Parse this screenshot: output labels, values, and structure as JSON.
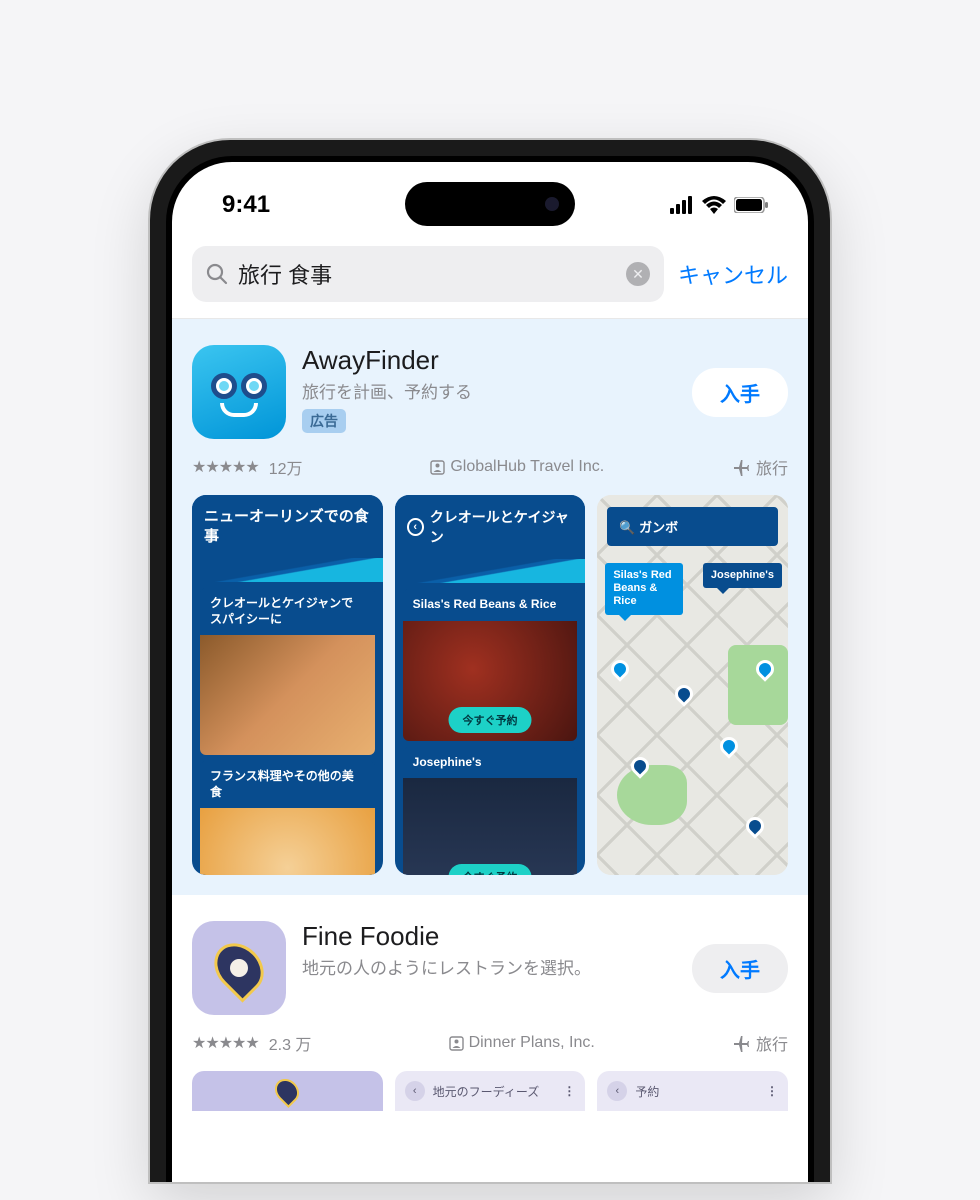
{
  "status": {
    "time": "9:41"
  },
  "search": {
    "query": "旅行 食事",
    "cancel": "キャンセル"
  },
  "ad": {
    "name": "AwayFinder",
    "subtitle": "旅行を計画、予約する",
    "badge": "広告",
    "get": "入手",
    "rating_count": "12万",
    "developer": "GlobalHub Travel Inc.",
    "category": "旅行",
    "shot1": {
      "title": "ニューオーリンズでの食事",
      "card1": "クレオールとケイジャンでスパイシーに",
      "card2": "フランス料理やその他の美食"
    },
    "shot2": {
      "title": "クレオールとケイジャン",
      "item1": "Silas's Red Beans & Rice",
      "item2": "Josephine's",
      "book": "今すぐ予約"
    },
    "shot3": {
      "search": "ガンボ",
      "label1": "Silas's Red Beans & Rice",
      "label2": "Josephine's"
    }
  },
  "result": {
    "name": "Fine Foodie",
    "subtitle": "地元の人のようにレストランを選択。",
    "get": "入手",
    "rating_count": "2.3 万",
    "developer": "Dinner Plans, Inc.",
    "category": "旅行",
    "shot2_label": "地元のフーディーズ",
    "shot3_label": "予約"
  }
}
